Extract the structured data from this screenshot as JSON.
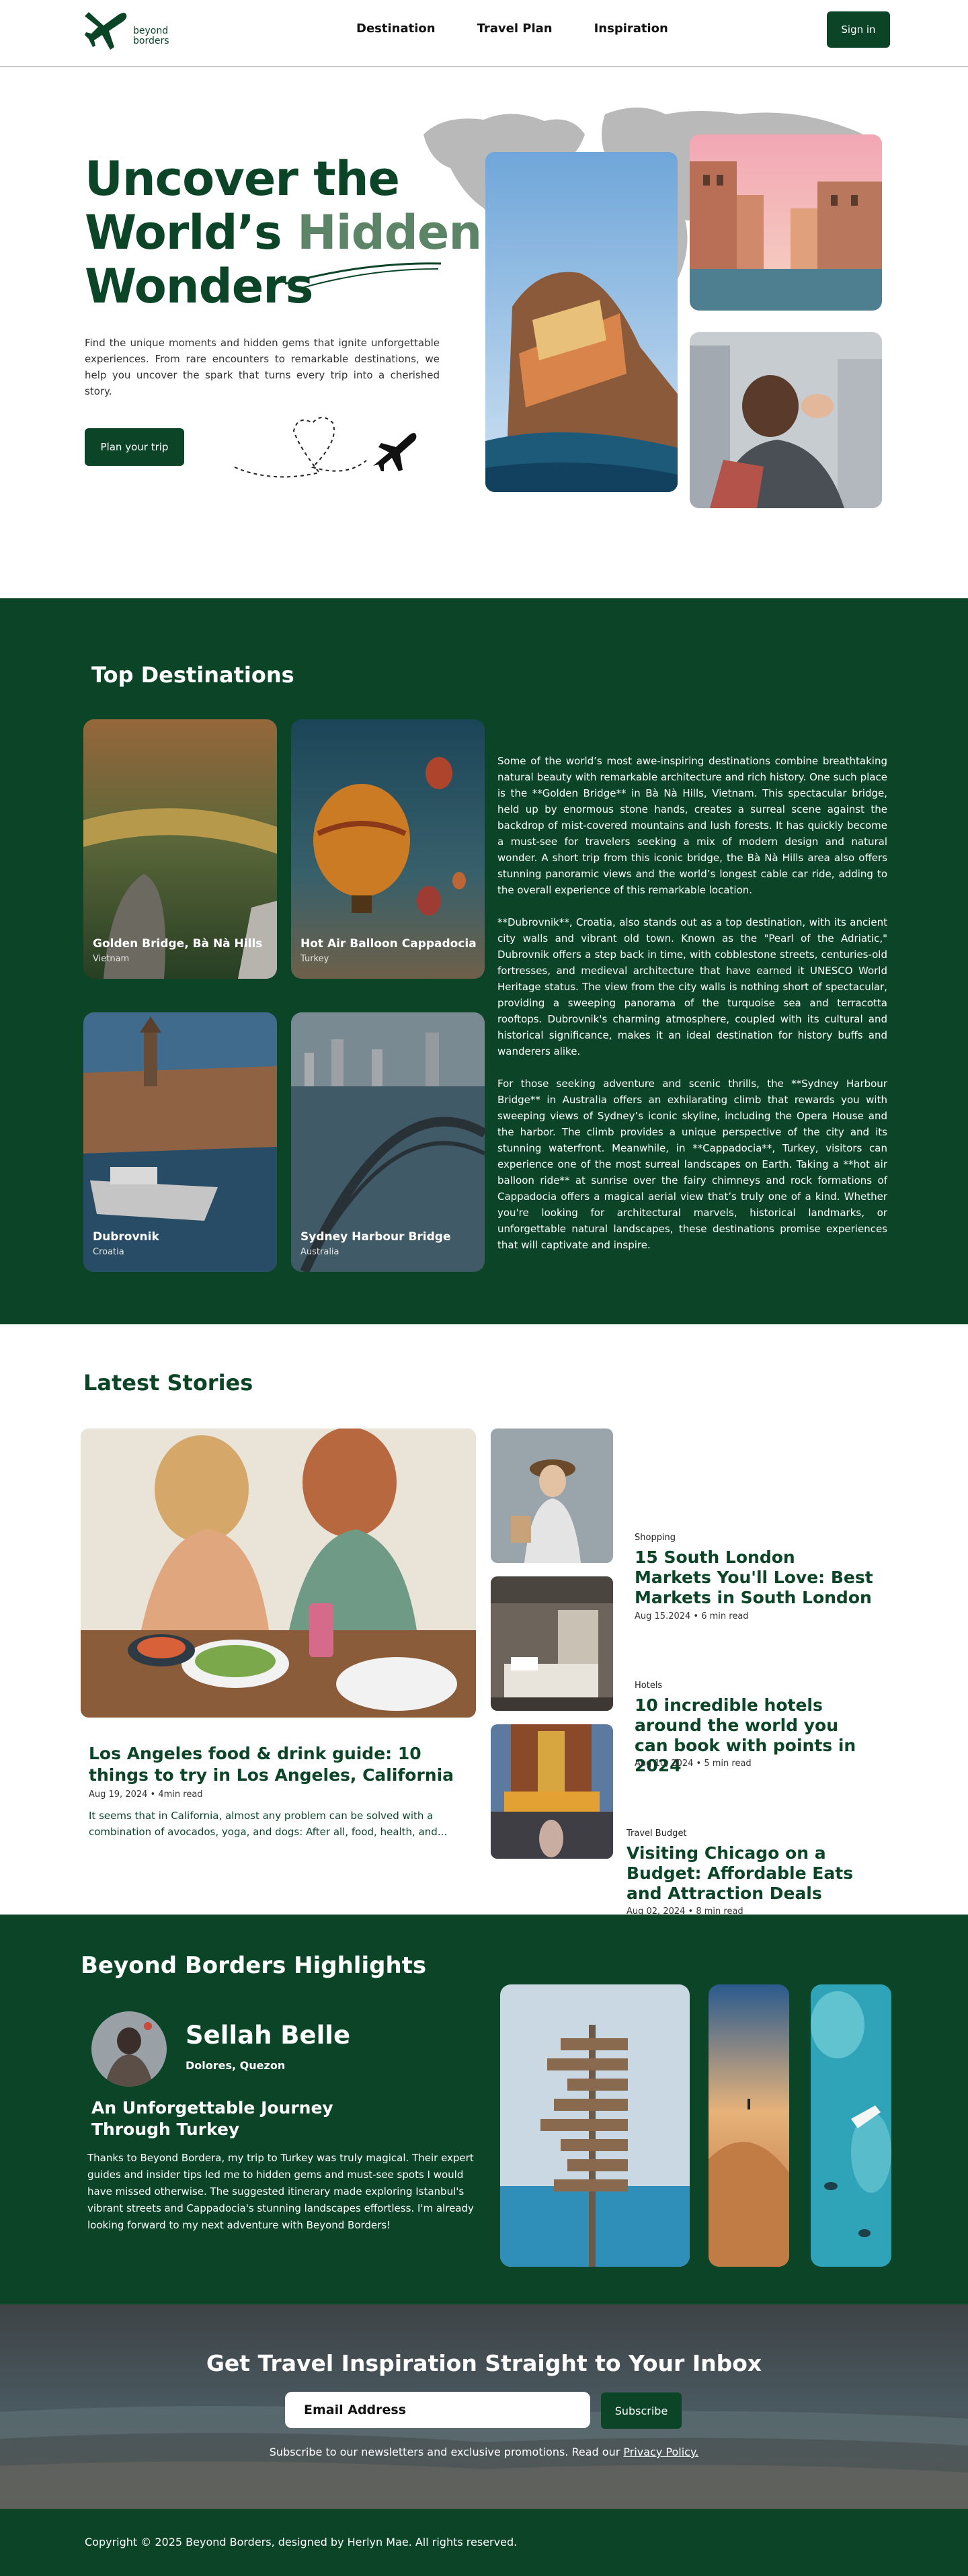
{
  "header": {
    "logo_line1": "beyond",
    "logo_line2": "borders",
    "nav": [
      "Destination",
      "Travel Plan",
      "Inspiration"
    ],
    "signin_label": "Sign in"
  },
  "hero": {
    "title_line1": "Uncover the",
    "title_line2a": "World’s",
    "title_line2b": "Hidden",
    "title_line3": "Wonders",
    "description": "Find the unique moments and hidden gems that ignite unforgettable experiences. From rare encounters to remarkable destinations, we help you uncover the spark that turns every trip into a cherished story.",
    "cta_label": "Plan your trip"
  },
  "top_destinations": {
    "title": "Top Destinations",
    "cards": [
      {
        "name": "Golden Bridge, Bà Nà Hills",
        "country": "Vietnam"
      },
      {
        "name": "Hot Air Balloon Cappadocia",
        "country": "Turkey"
      },
      {
        "name": "Dubrovnik",
        "country": "Croatia"
      },
      {
        "name": "Sydney Harbour Bridge",
        "country": "Australia"
      }
    ],
    "paragraphs": [
      "Some of the world’s most awe-inspiring destinations combine breathtaking natural beauty with remarkable architecture and rich history. One such place is the **Golden Bridge** in Bà Nà Hills, Vietnam. This spectacular bridge, held up by enormous stone hands, creates a surreal scene against the backdrop of mist-covered mountains and lush forests. It has quickly become a must-see for travelers seeking a mix of modern design and natural wonder. A short trip from this iconic bridge, the Bà Nà Hills area also offers stunning panoramic views and the world’s longest cable car ride, adding to the overall experience of this remarkable location.",
      "**Dubrovnik**, Croatia, also stands out as a top destination, with its ancient city walls and vibrant old town. Known as the \"Pearl of the Adriatic,\" Dubrovnik offers a step back in time, with cobblestone streets, centuries-old fortresses, and medieval architecture that have earned it UNESCO World Heritage status. The view from the city walls is nothing short of spectacular, providing a sweeping panorama of the turquoise sea and terracotta rooftops. Dubrovnik's charming atmosphere, coupled with its cultural and historical significance, makes it an ideal destination for history buffs and wanderers alike.",
      "For those seeking adventure and scenic thrills, the **Sydney Harbour Bridge** in Australia offers an exhilarating climb that rewards you with sweeping views of Sydney’s iconic skyline, including the Opera House and the harbor. The climb provides a unique perspective of the city and its stunning waterfront. Meanwhile, in **Cappadocia**, Turkey, visitors can experience one of the most surreal landscapes on Earth. Taking a **hot air balloon ride** at sunrise over the fairy chimneys and rock formations of Cappadocia offers a magical aerial view that’s truly one of a kind. Whether you're looking for architectural marvels, historical landmarks, or unforgettable natural landscapes, these destinations promise experiences that will captivate and inspire."
    ]
  },
  "stories": {
    "title": "Latest Stories",
    "featured": {
      "title": "Los Angeles food & drink guide: 10 things to try in Los Angeles, California",
      "meta": "Aug 19, 2024 • 4min read",
      "excerpt": "It seems that in California, almost any problem can be solved with a combination of avocados, yoga, and dogs: After all, food, health, and..."
    },
    "items": [
      {
        "category": "Shopping",
        "title": "15 South London Markets You'll Love: Best Markets in South London",
        "meta": "Aug 15.2024 • 6 min read"
      },
      {
        "category": "Hotels",
        "title": "10 incredible hotels around the world you can book with points in 2024",
        "meta": "Aug 10, 2024 • 5 min read"
      },
      {
        "category": "Travel Budget",
        "title": "Visiting Chicago on a Budget: Affordable Eats and Attraction Deals",
        "meta": "Aug 02, 2024 • 8 min read"
      }
    ]
  },
  "highlights": {
    "title": "Beyond Borders Highlights",
    "name": "Sellah Belle",
    "location": "Dolores, Quezon",
    "headline": "An Unforgettable Journey Through Turkey",
    "quote": "Thanks to Beyond Bordera, my trip to Turkey was truly magical. Their expert guides and insider tips led me to hidden gems and must-see spots I would have missed otherwise. The suggested itinerary made exploring Istanbul's vibrant streets and Cappadocia's stunning landscapes effortless. I'm already looking forward to my next adventure with Beyond Borders!"
  },
  "newsletter": {
    "title": "Get Travel Inspiration Straight to Your Inbox",
    "email_placeholder": "Email Address",
    "subscribe_label": "Subscribe",
    "note_prefix": "Subscribe to our newsletters and exclusive promotions. Read our",
    "note_link": "Privacy Policy."
  },
  "footer": {
    "copyright": "Copyright © 2025 Beyond Borders, designed by Herlyn Mae. All rights reserved."
  },
  "colors": {
    "primary": "#0b4427",
    "accent": "#5b8566"
  },
  "icons": [
    "plane-logo-icon",
    "plane-icon",
    "heart-path-icon"
  ]
}
